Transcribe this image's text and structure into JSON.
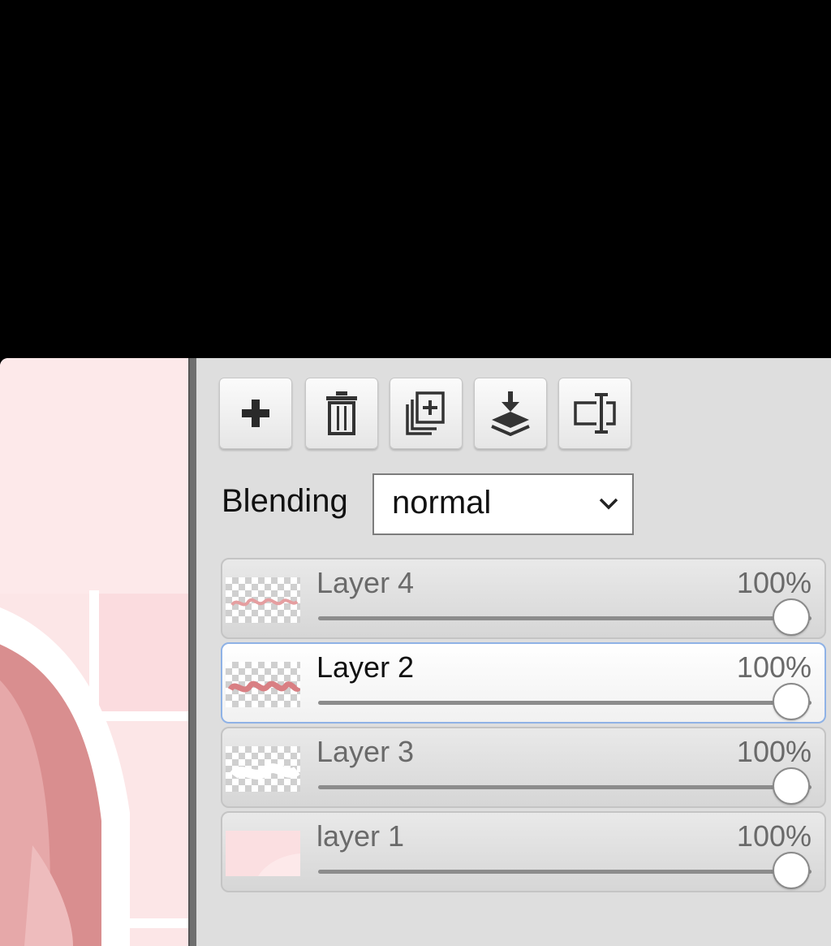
{
  "toolbar": {
    "buttons": [
      {
        "name": "add-layer",
        "icon": "plus-icon"
      },
      {
        "name": "delete-layer",
        "icon": "trash-icon"
      },
      {
        "name": "duplicate-layer",
        "icon": "duplicate-icon"
      },
      {
        "name": "merge-down",
        "icon": "merge-down-icon"
      },
      {
        "name": "rename-layer",
        "icon": "rename-icon"
      }
    ]
  },
  "blending": {
    "label": "Blending",
    "selected": "normal"
  },
  "layers": [
    {
      "name": "Layer 4",
      "opacity_label": "100%",
      "opacity": 1.0,
      "selected": false,
      "thumb": "pink-script-on-transparent"
    },
    {
      "name": "Layer 2",
      "opacity_label": "100%",
      "opacity": 1.0,
      "selected": true,
      "thumb": "pink-script-on-transparent"
    },
    {
      "name": "Layer 3",
      "opacity_label": "100%",
      "opacity": 1.0,
      "selected": false,
      "thumb": "white-shape-on-transparent"
    },
    {
      "name": "layer 1",
      "opacity_label": "100%",
      "opacity": 1.0,
      "selected": false,
      "thumb": "pink-background"
    }
  ],
  "colors": {
    "panel": "#dedede",
    "selection_border": "#8fb2e6",
    "canvas_pink": "#fce6e7",
    "shape_dark_pink": "#d98e8f"
  }
}
